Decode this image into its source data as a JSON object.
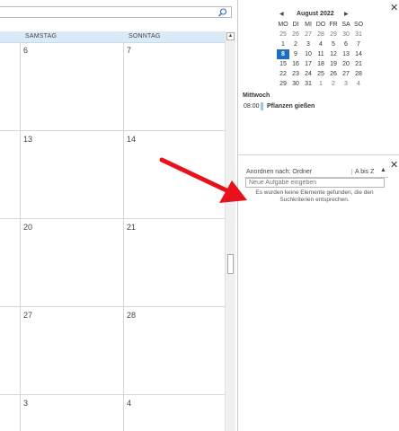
{
  "search": {
    "placeholder": "",
    "icon": "search-icon"
  },
  "calendar": {
    "day_headers": [
      "SAMSTAG",
      "SONNTAG"
    ],
    "weeks": [
      [
        "6",
        "7"
      ],
      [
        "13",
        "14"
      ],
      [
        "20",
        "21"
      ],
      [
        "27",
        "28"
      ],
      [
        "3",
        "4"
      ]
    ]
  },
  "mini_calendar": {
    "title": "August 2022",
    "prev_icon": "triangle-left-icon",
    "next_icon": "triangle-right-icon",
    "dow": [
      "MO",
      "DI",
      "MI",
      "DO",
      "FR",
      "SA",
      "SO"
    ],
    "days": [
      [
        "25",
        "26",
        "27",
        "28",
        "29",
        "30",
        "31"
      ],
      [
        "1",
        "2",
        "3",
        "4",
        "5",
        "6",
        "7"
      ],
      [
        "8",
        "9",
        "10",
        "11",
        "12",
        "13",
        "14"
      ],
      [
        "15",
        "16",
        "17",
        "18",
        "19",
        "20",
        "21"
      ],
      [
        "22",
        "23",
        "24",
        "25",
        "26",
        "27",
        "28"
      ],
      [
        "29",
        "30",
        "31",
        "1",
        "2",
        "3",
        "4"
      ]
    ],
    "today": "8",
    "accent_color": "#1b6ec2"
  },
  "agenda": {
    "day_label": "Mittwoch",
    "time": "08:00",
    "title": "Pflanzen gießen"
  },
  "tasks": {
    "arrange_label": "Anordnen nach: Ordner",
    "sort_label": "A bis Z",
    "new_task_placeholder": "Neue Aufgabe eingeben",
    "empty_message": "Es wurden keine Elemente gefunden, die den Suchkriterien entsprechen."
  },
  "annotation": {
    "arrow_color": "#e8101a"
  }
}
